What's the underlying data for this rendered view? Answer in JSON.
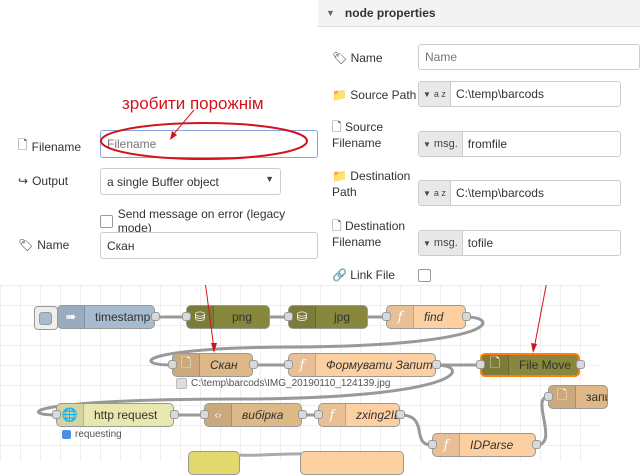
{
  "file_in_panel": {
    "annotation": "зробити порожнім",
    "filename": {
      "label": "Filename",
      "value": "",
      "placeholder": "Filename"
    },
    "output": {
      "label": "Output",
      "selected": "a single Buffer object"
    },
    "legacy_checkbox": {
      "label": "Send message on error (legacy mode)",
      "checked": false
    },
    "name": {
      "label": "Name",
      "value": "Скан"
    }
  },
  "node_properties": {
    "header": "node properties",
    "name": {
      "label": "Name",
      "value": "",
      "placeholder": "Name"
    },
    "source_path": {
      "label": "Source Path",
      "type": "a z",
      "value": "C:\\temp\\barcods"
    },
    "source_filename": {
      "label_line1": "Source",
      "label_line2": "Filename",
      "type": "msg.",
      "value": "fromfile"
    },
    "destination_path": {
      "label_line1": "Destination",
      "label_line2": "Path",
      "type": "a z",
      "value": "C:\\temp\\barcods"
    },
    "destination_filename": {
      "label_line1": "Destination",
      "label_line2": "Filename",
      "type": "msg.",
      "value": "tofile"
    },
    "link_file": {
      "label": "Link File",
      "checked": false
    }
  },
  "flow": {
    "nodes": [
      {
        "label": "timestamp",
        "type": "inject",
        "color": "#a6bbcf"
      },
      {
        "label": "png",
        "type": "storage",
        "color": "#87873d"
      },
      {
        "label": "jpg",
        "type": "storage",
        "color": "#87873d"
      },
      {
        "label": "find",
        "type": "function",
        "color": "#fdd0a2"
      },
      {
        "label": "Скан",
        "type": "file-in",
        "color": "#deb887"
      },
      {
        "label": "Формувати Запит",
        "type": "function",
        "color": "#fdd0a2"
      },
      {
        "label": "File Move",
        "type": "file-move",
        "color": "#87873d"
      },
      {
        "label": "http request",
        "type": "http",
        "color": "#e7e7ae"
      },
      {
        "label": "вибірка",
        "type": "template",
        "color": "#deb887"
      },
      {
        "label": "zxing2ID",
        "type": "function",
        "color": "#fdd0a2"
      },
      {
        "label": "IDParse",
        "type": "function",
        "color": "#fdd0a2"
      },
      {
        "label": "запи",
        "type": "file",
        "color": "#deb887"
      }
    ],
    "status_scan": "C:\\temp\\barcods\\IMG_20190110_124139.jpg",
    "status_http": "requesting"
  }
}
